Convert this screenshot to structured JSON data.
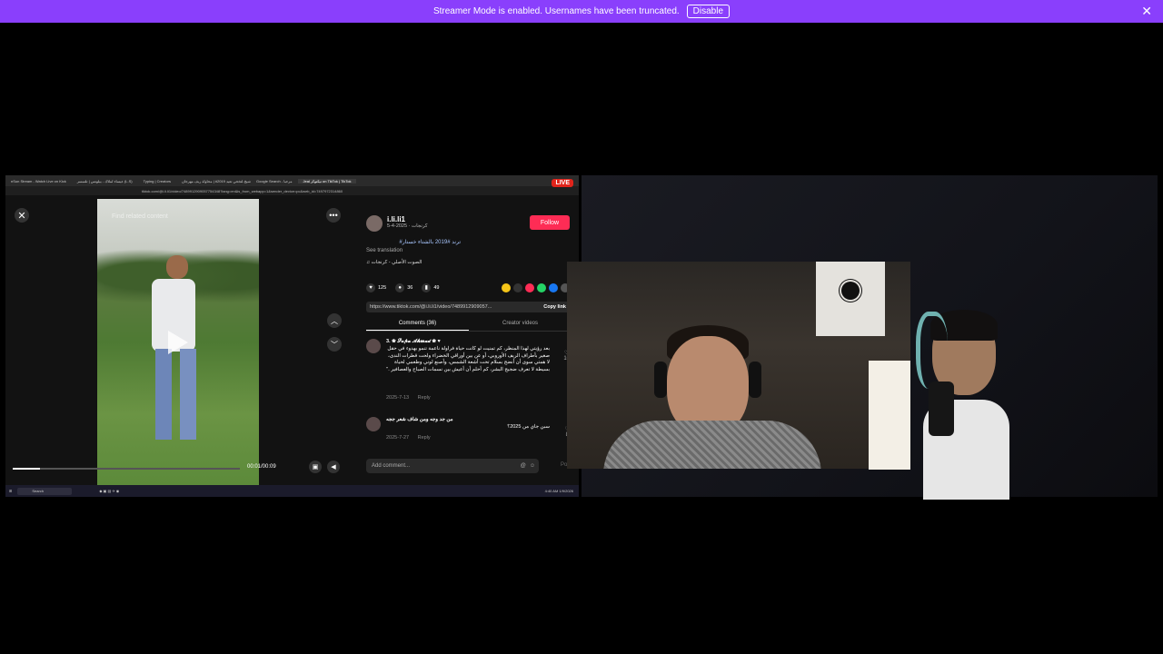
{
  "banner": {
    "message": "Streamer Mode is enabled. Usernames have been truncated.",
    "disable_label": "Disable",
    "close_glyph": "✕",
    "color": "#8a3ffc"
  },
  "browser": {
    "tabs": [
      "nSun Stream - Watch Live on Kick",
      "عيساء لملاك - بيلونس | تلتمسر (L.S)",
      "Typing | Creators",
      "شيخ-لتخحي تعيد 2019# | محاولة ريف مهرجان",
      "Google Search - مرحبا",
      "Jeal تيكتوكر on TikTok | TikTok"
    ],
    "url": "tiktok.com/@i.li.li1/video/7489912909057754348?lang=en&is_from_webapp=1&sender_device=pc&web_id=7497972314860",
    "live_label": "LIVE"
  },
  "player": {
    "close_glyph": "✕",
    "more_glyph": "•••",
    "overlay_text": "Find related content",
    "up_glyph": "︿",
    "down_glyph": "﹀",
    "time": "00:01/00:09",
    "progress": 0.12
  },
  "panel": {
    "author_name": "i.li.li1",
    "author_sub": "كرنجات · 2025-4-5",
    "follow_label": "Follow",
    "description": "#ترند #2019 بالشتاء خستار",
    "see_translation": "See translation",
    "sound": "♫ الصوت الأصلي - كرنجات",
    "likes": "125",
    "comments_count": "36",
    "saves": "49",
    "link": "https://www.tiktok.com/@i.li.li1/video/7489912909057...",
    "copy_label": "Copy link",
    "tab_comments": "Comments (36)",
    "tab_creator": "Creator videos",
    "comments": [
      {
        "name": "3. ❀ 𝓢𝓪𝓹𝓪 𝓐𝓱𝓶𝓪𝓭 ❀ ♥",
        "text": "بعد رؤيتي لهذا المنظر، كم تمنيت لو كانت حياة فراولة ناعمة تنمو بهدوء في حقل صغير بأطراف الريف الأوروبي، أو عن بين أوراقي الخضراء ولحت قطرات الندى، لا همتي سوى أن أنضج بسلام تحت أشعة الشمس، وأصنع لوني وطعمي لحياة بسيطة لا تعرف ضجيج البشر، كم أحلم أن أعيش بين نسمات الصباح والعصافير .\"",
        "date": "2025-7-13",
        "reply": "Reply",
        "likes": "10"
      },
      {
        "name": "من جد وجه ومن شاف شعر ججه",
        "text": "سبن جاي من 2025؟",
        "date": "2025-7-27",
        "reply": "Reply",
        "likes": "8"
      }
    ],
    "add_comment_placeholder": "Add comment...",
    "post_label": "Post"
  },
  "taskbar": {
    "search_label": "Search",
    "clock_time": "4:40 AM",
    "clock_date": "1/9/2026"
  }
}
